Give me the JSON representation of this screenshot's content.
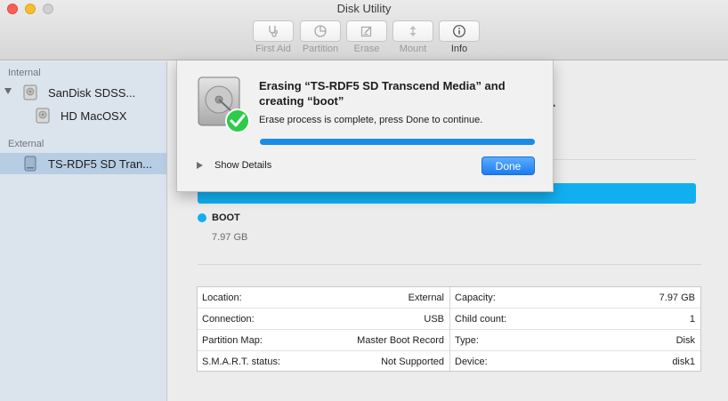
{
  "window": {
    "title": "Disk Utility"
  },
  "toolbar": {
    "buttons": [
      {
        "label": "First Aid",
        "icon": "stethoscope-icon",
        "enabled": false
      },
      {
        "label": "Partition",
        "icon": "partition-pie-icon",
        "enabled": false
      },
      {
        "label": "Erase",
        "icon": "erase-icon",
        "enabled": false
      },
      {
        "label": "Mount",
        "icon": "mount-icon",
        "enabled": false
      },
      {
        "label": "Info",
        "icon": "info-icon",
        "enabled": true
      }
    ]
  },
  "sidebar": {
    "sections": [
      {
        "label": "Internal"
      },
      {
        "label": "External"
      }
    ],
    "items": [
      {
        "label": "SanDisk SDSS...",
        "icon": "internal-drive-icon",
        "expanded": true
      },
      {
        "label": "HD MacOSX",
        "icon": "volume-icon"
      },
      {
        "label": "TS-RDF5 SD Tran...",
        "icon": "external-drive-icon",
        "selected": true
      }
    ]
  },
  "content": {
    "partition": {
      "name": "BOOT",
      "size": "7.97 GB",
      "color": "#12aff0"
    },
    "info_left": [
      {
        "key": "Location:",
        "value": "External"
      },
      {
        "key": "Connection:",
        "value": "USB"
      },
      {
        "key": "Partition Map:",
        "value": "Master Boot Record"
      },
      {
        "key": "S.M.A.R.T. status:",
        "value": "Not Supported"
      }
    ],
    "info_right": [
      {
        "key": "Capacity:",
        "value": "7.97 GB"
      },
      {
        "key": "Child count:",
        "value": "1"
      },
      {
        "key": "Type:",
        "value": "Disk"
      },
      {
        "key": "Device:",
        "value": "disk1"
      }
    ]
  },
  "sheet": {
    "title": "Erasing “TS-RDF5 SD Transcend Media” and creating “boot”",
    "message": "Erase process is complete, press Done to continue.",
    "progress": 1.0,
    "show_details_label": "Show Details",
    "done_label": "Done",
    "accent_color": "#1a8ce6"
  }
}
